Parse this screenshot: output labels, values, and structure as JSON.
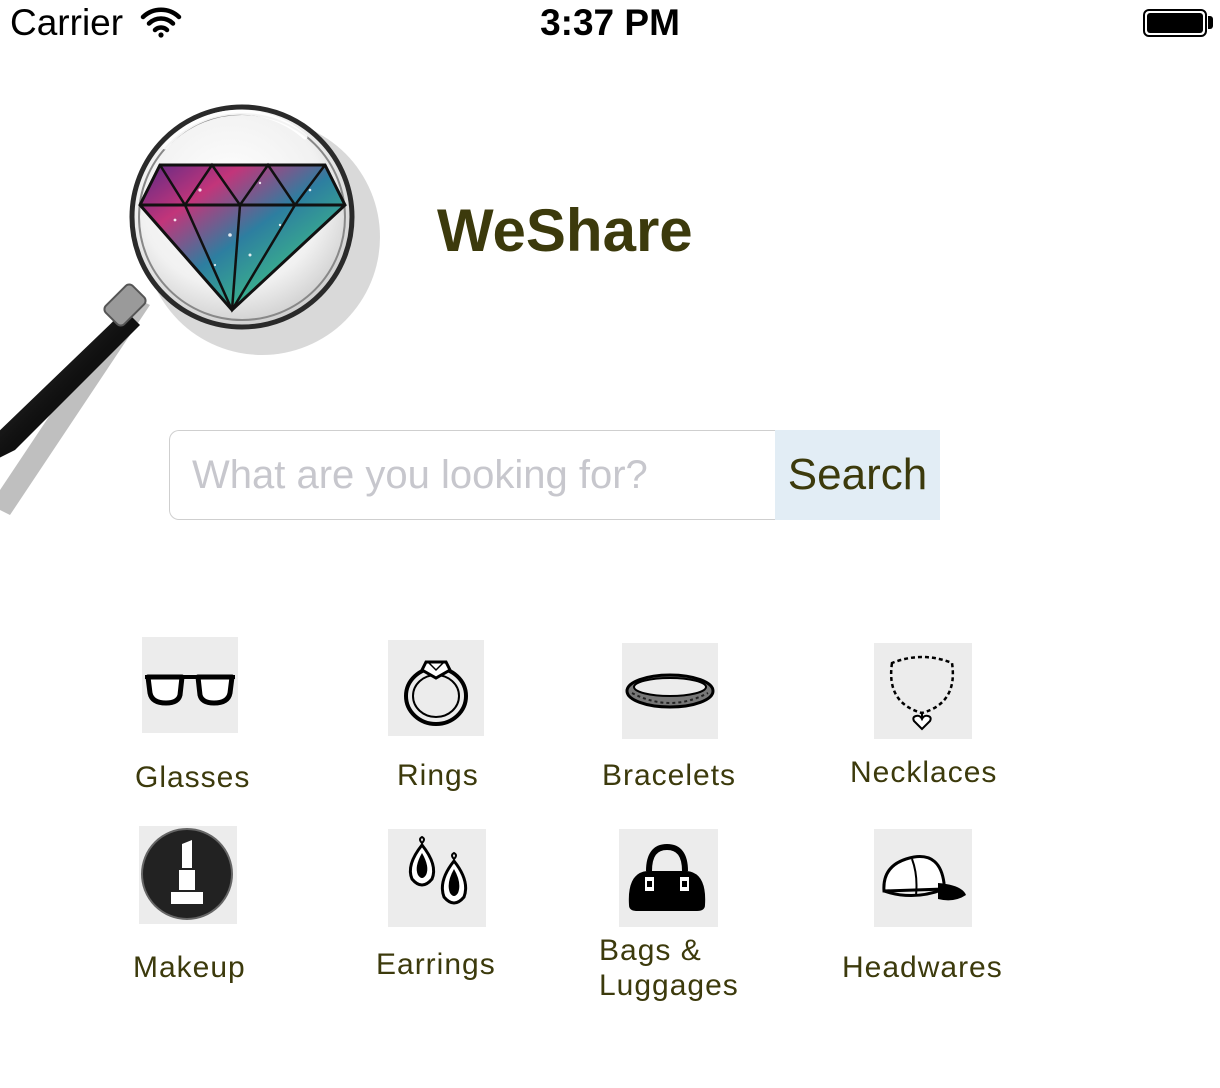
{
  "status_bar": {
    "carrier": "Carrier",
    "time": "3:37 PM",
    "wifi_icon": "wifi-icon",
    "battery_icon": "battery-icon"
  },
  "header": {
    "logo": "magnifier-diamond-logo",
    "title": "WeShare"
  },
  "search": {
    "value": "",
    "placeholder": "What are you looking for?",
    "button_label": "Search"
  },
  "categories": [
    {
      "label": "Glasses",
      "icon": "glasses-icon"
    },
    {
      "label": "Rings",
      "icon": "ring-icon"
    },
    {
      "label": "Bracelets",
      "icon": "bracelet-icon"
    },
    {
      "label": "Necklaces",
      "icon": "necklace-icon"
    },
    {
      "label": "Makeup",
      "icon": "lipstick-icon"
    },
    {
      "label": "Earrings",
      "icon": "earrings-icon"
    },
    {
      "label": "Bags & Luggages",
      "icon": "handbag-icon"
    },
    {
      "label": "Headwares",
      "icon": "cap-icon"
    }
  ],
  "colors": {
    "title": "#3c3a0c",
    "search_button_bg": "#e2edf5",
    "tile_bg": "#ececec"
  }
}
